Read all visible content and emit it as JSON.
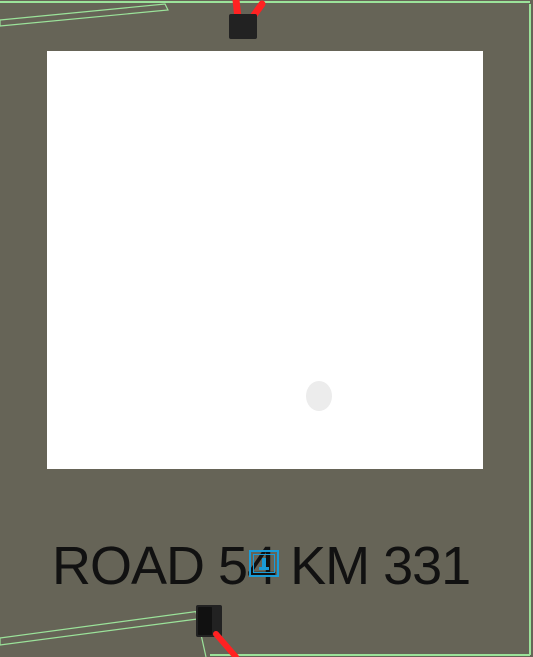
{
  "sign": {
    "text": "ROAD 54 KM 331"
  },
  "scene": {
    "background_color": "#666457",
    "panel_color": "#ffffff",
    "edge_line_color": "#9be39a",
    "marker_color": "#1a9bd7",
    "post_color": "#222222",
    "post_accent_color": "#ff2222"
  },
  "icons": {
    "marker": "selection-marker-icon",
    "post_top": "post-top-icon",
    "post_bottom": "post-bottom-icon"
  }
}
